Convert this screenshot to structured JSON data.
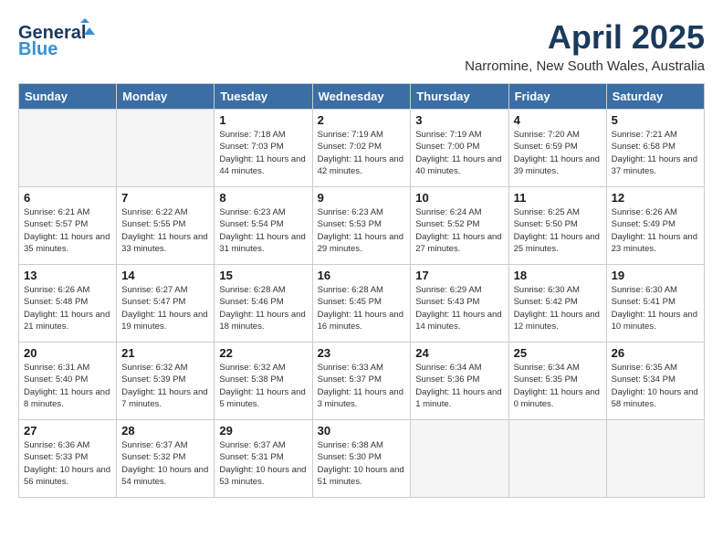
{
  "header": {
    "logo_general": "General",
    "logo_blue": "Blue",
    "month": "April 2025",
    "location": "Narromine, New South Wales, Australia"
  },
  "days_of_week": [
    "Sunday",
    "Monday",
    "Tuesday",
    "Wednesday",
    "Thursday",
    "Friday",
    "Saturday"
  ],
  "weeks": [
    [
      {
        "day": "",
        "empty": true
      },
      {
        "day": "",
        "empty": true
      },
      {
        "day": "1",
        "sunrise": "Sunrise: 7:18 AM",
        "sunset": "Sunset: 7:03 PM",
        "daylight": "Daylight: 11 hours and 44 minutes."
      },
      {
        "day": "2",
        "sunrise": "Sunrise: 7:19 AM",
        "sunset": "Sunset: 7:02 PM",
        "daylight": "Daylight: 11 hours and 42 minutes."
      },
      {
        "day": "3",
        "sunrise": "Sunrise: 7:19 AM",
        "sunset": "Sunset: 7:00 PM",
        "daylight": "Daylight: 11 hours and 40 minutes."
      },
      {
        "day": "4",
        "sunrise": "Sunrise: 7:20 AM",
        "sunset": "Sunset: 6:59 PM",
        "daylight": "Daylight: 11 hours and 39 minutes."
      },
      {
        "day": "5",
        "sunrise": "Sunrise: 7:21 AM",
        "sunset": "Sunset: 6:58 PM",
        "daylight": "Daylight: 11 hours and 37 minutes."
      }
    ],
    [
      {
        "day": "6",
        "sunrise": "Sunrise: 6:21 AM",
        "sunset": "Sunset: 5:57 PM",
        "daylight": "Daylight: 11 hours and 35 minutes."
      },
      {
        "day": "7",
        "sunrise": "Sunrise: 6:22 AM",
        "sunset": "Sunset: 5:55 PM",
        "daylight": "Daylight: 11 hours and 33 minutes."
      },
      {
        "day": "8",
        "sunrise": "Sunrise: 6:23 AM",
        "sunset": "Sunset: 5:54 PM",
        "daylight": "Daylight: 11 hours and 31 minutes."
      },
      {
        "day": "9",
        "sunrise": "Sunrise: 6:23 AM",
        "sunset": "Sunset: 5:53 PM",
        "daylight": "Daylight: 11 hours and 29 minutes."
      },
      {
        "day": "10",
        "sunrise": "Sunrise: 6:24 AM",
        "sunset": "Sunset: 5:52 PM",
        "daylight": "Daylight: 11 hours and 27 minutes."
      },
      {
        "day": "11",
        "sunrise": "Sunrise: 6:25 AM",
        "sunset": "Sunset: 5:50 PM",
        "daylight": "Daylight: 11 hours and 25 minutes."
      },
      {
        "day": "12",
        "sunrise": "Sunrise: 6:26 AM",
        "sunset": "Sunset: 5:49 PM",
        "daylight": "Daylight: 11 hours and 23 minutes."
      }
    ],
    [
      {
        "day": "13",
        "sunrise": "Sunrise: 6:26 AM",
        "sunset": "Sunset: 5:48 PM",
        "daylight": "Daylight: 11 hours and 21 minutes."
      },
      {
        "day": "14",
        "sunrise": "Sunrise: 6:27 AM",
        "sunset": "Sunset: 5:47 PM",
        "daylight": "Daylight: 11 hours and 19 minutes."
      },
      {
        "day": "15",
        "sunrise": "Sunrise: 6:28 AM",
        "sunset": "Sunset: 5:46 PM",
        "daylight": "Daylight: 11 hours and 18 minutes."
      },
      {
        "day": "16",
        "sunrise": "Sunrise: 6:28 AM",
        "sunset": "Sunset: 5:45 PM",
        "daylight": "Daylight: 11 hours and 16 minutes."
      },
      {
        "day": "17",
        "sunrise": "Sunrise: 6:29 AM",
        "sunset": "Sunset: 5:43 PM",
        "daylight": "Daylight: 11 hours and 14 minutes."
      },
      {
        "day": "18",
        "sunrise": "Sunrise: 6:30 AM",
        "sunset": "Sunset: 5:42 PM",
        "daylight": "Daylight: 11 hours and 12 minutes."
      },
      {
        "day": "19",
        "sunrise": "Sunrise: 6:30 AM",
        "sunset": "Sunset: 5:41 PM",
        "daylight": "Daylight: 11 hours and 10 minutes."
      }
    ],
    [
      {
        "day": "20",
        "sunrise": "Sunrise: 6:31 AM",
        "sunset": "Sunset: 5:40 PM",
        "daylight": "Daylight: 11 hours and 8 minutes."
      },
      {
        "day": "21",
        "sunrise": "Sunrise: 6:32 AM",
        "sunset": "Sunset: 5:39 PM",
        "daylight": "Daylight: 11 hours and 7 minutes."
      },
      {
        "day": "22",
        "sunrise": "Sunrise: 6:32 AM",
        "sunset": "Sunset: 5:38 PM",
        "daylight": "Daylight: 11 hours and 5 minutes."
      },
      {
        "day": "23",
        "sunrise": "Sunrise: 6:33 AM",
        "sunset": "Sunset: 5:37 PM",
        "daylight": "Daylight: 11 hours and 3 minutes."
      },
      {
        "day": "24",
        "sunrise": "Sunrise: 6:34 AM",
        "sunset": "Sunset: 5:36 PM",
        "daylight": "Daylight: 11 hours and 1 minute."
      },
      {
        "day": "25",
        "sunrise": "Sunrise: 6:34 AM",
        "sunset": "Sunset: 5:35 PM",
        "daylight": "Daylight: 11 hours and 0 minutes."
      },
      {
        "day": "26",
        "sunrise": "Sunrise: 6:35 AM",
        "sunset": "Sunset: 5:34 PM",
        "daylight": "Daylight: 10 hours and 58 minutes."
      }
    ],
    [
      {
        "day": "27",
        "sunrise": "Sunrise: 6:36 AM",
        "sunset": "Sunset: 5:33 PM",
        "daylight": "Daylight: 10 hours and 56 minutes."
      },
      {
        "day": "28",
        "sunrise": "Sunrise: 6:37 AM",
        "sunset": "Sunset: 5:32 PM",
        "daylight": "Daylight: 10 hours and 54 minutes."
      },
      {
        "day": "29",
        "sunrise": "Sunrise: 6:37 AM",
        "sunset": "Sunset: 5:31 PM",
        "daylight": "Daylight: 10 hours and 53 minutes."
      },
      {
        "day": "30",
        "sunrise": "Sunrise: 6:38 AM",
        "sunset": "Sunset: 5:30 PM",
        "daylight": "Daylight: 10 hours and 51 minutes."
      },
      {
        "day": "",
        "empty": true
      },
      {
        "day": "",
        "empty": true
      },
      {
        "day": "",
        "empty": true
      }
    ]
  ]
}
